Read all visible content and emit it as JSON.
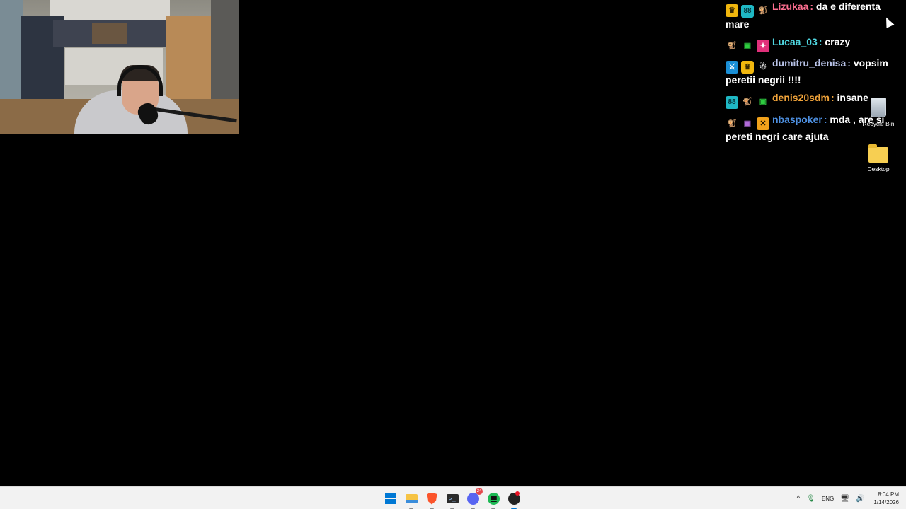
{
  "chat": {
    "messages": [
      {
        "badges": [
          "crown",
          "88",
          "monkey"
        ],
        "user": "Lizukaa",
        "user_color": "#ff6f91",
        "text": "da e diferenta mare"
      },
      {
        "badges": [
          "monkey",
          "gift",
          "pink"
        ],
        "user": "Lucaa_03",
        "user_color": "#4fd6e0",
        "text": "crazy"
      },
      {
        "badges": [
          "mod",
          "crown",
          "snow"
        ],
        "user": "dumitru_denisa",
        "user_color": "#b9c3e8",
        "text": "vopsim peretii negrii !!!!"
      },
      {
        "badges": [
          "88",
          "monkey",
          "gift"
        ],
        "user": "denis20sdm",
        "user_color": "#f0a33a",
        "text": "insane"
      },
      {
        "badges": [
          "monkey",
          "gift-purple",
          "pred"
        ],
        "user": "nbaspoker",
        "user_color": "#4d8fe0",
        "text": "mda , are si pereti negri care ajuta"
      }
    ],
    "separator": ":"
  },
  "desktop": {
    "icons": [
      {
        "label": "Recycle Bin",
        "icon": "recycle-bin-icon"
      },
      {
        "label": "Desktop",
        "icon": "folder-icon"
      }
    ]
  },
  "taskbar": {
    "apps": [
      {
        "name": "start",
        "icon": "windows-start-icon"
      },
      {
        "name": "file-explorer",
        "icon": "folder-icon"
      },
      {
        "name": "brave",
        "icon": "brave-browser-icon"
      },
      {
        "name": "terminal",
        "icon": "terminal-icon",
        "glyph": ">_"
      },
      {
        "name": "discord",
        "icon": "discord-icon",
        "badge": "24"
      },
      {
        "name": "spotify",
        "icon": "spotify-icon"
      },
      {
        "name": "obs",
        "icon": "obs-icon"
      }
    ],
    "tray": {
      "language": "ENG",
      "time": "8:04 PM",
      "date": "1/14/2026"
    }
  }
}
